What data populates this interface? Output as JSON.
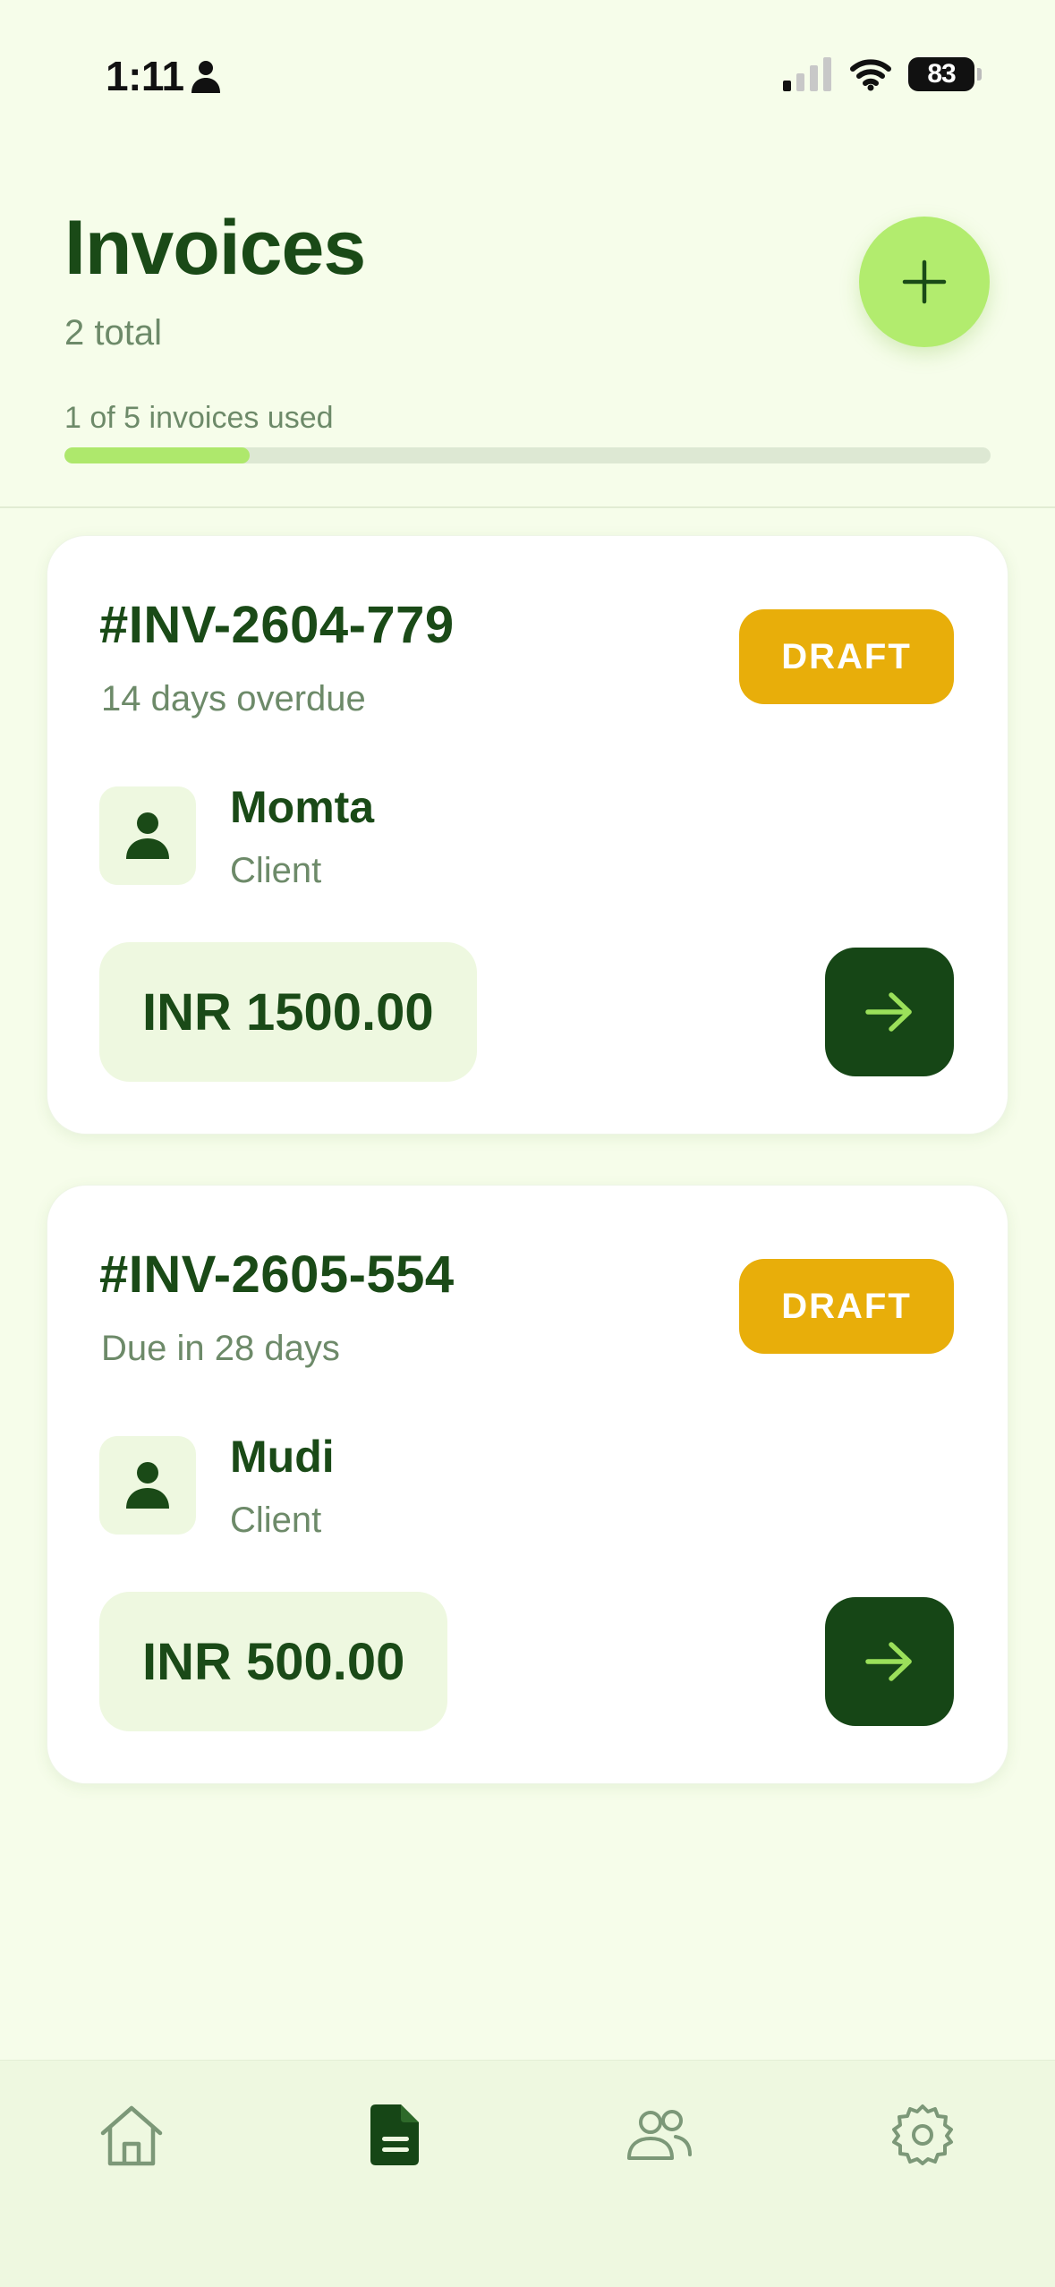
{
  "status_bar": {
    "time": "1:11",
    "battery": "83",
    "icons": [
      "person-icon",
      "signal-icon",
      "wifi-icon",
      "battery-icon"
    ]
  },
  "header": {
    "title": "Invoices",
    "total": "2 total",
    "usage_text": "1 of 5 invoices used",
    "usage_fraction": 0.2,
    "add_icon": "plus-icon"
  },
  "invoices": [
    {
      "number": "#INV-2604-779",
      "due_text": "14 days overdue",
      "status": "DRAFT",
      "client_name": "Momta",
      "client_role": "Client",
      "amount": "INR 1500.00"
    },
    {
      "number": "#INV-2605-554",
      "due_text": "Due in 28 days",
      "status": "DRAFT",
      "client_name": "Mudi",
      "client_role": "Client",
      "amount": "INR 500.00"
    }
  ],
  "nav": {
    "items": [
      "home-icon",
      "invoices-icon",
      "clients-icon",
      "settings-icon"
    ],
    "active": "invoices-icon"
  },
  "colors": {
    "background": "#f6fdea",
    "primary_dark": "#164616",
    "accent_green": "#b2ec6e",
    "draft_badge": "#e8ae0a",
    "muted_text": "#6d8a69"
  }
}
